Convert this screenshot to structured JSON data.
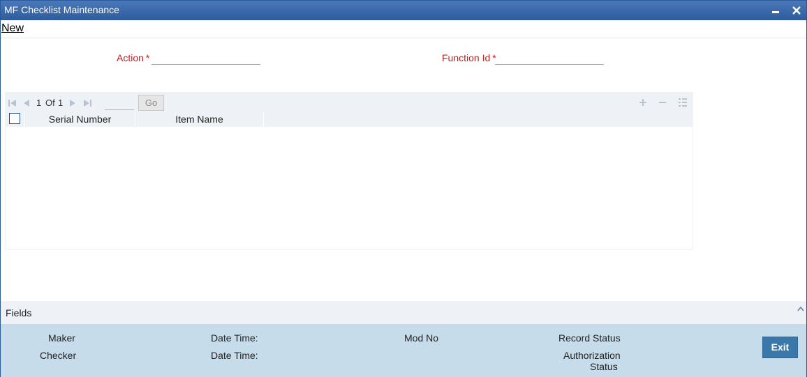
{
  "window": {
    "title": "MF Checklist Maintenance"
  },
  "menu": {
    "new_label": "New"
  },
  "form": {
    "action_label": "Action",
    "function_id_label": "Function Id",
    "required_marker": "*",
    "action_value": "",
    "function_id_value": ""
  },
  "grid": {
    "pagination": {
      "current": "1",
      "of_label": "Of",
      "total": "1",
      "page_input": "",
      "go_label": "Go"
    },
    "columns": [
      "Serial Number",
      "Item Name"
    ],
    "rows": []
  },
  "footer": {
    "fields_label": "Fields",
    "maker_label": "Maker",
    "checker_label": "Checker",
    "date_time_label_1": "Date Time:",
    "date_time_label_2": "Date Time:",
    "mod_no_label": "Mod No",
    "record_status_label": "Record Status",
    "authorization_label": "Authorization",
    "status_label": "Status",
    "exit_label": "Exit"
  },
  "colors": {
    "title_bar": "#2d5b9c",
    "required_label": "#c41e1e",
    "audit_panel": "#c7dcea",
    "exit_button": "#3a78ab"
  }
}
